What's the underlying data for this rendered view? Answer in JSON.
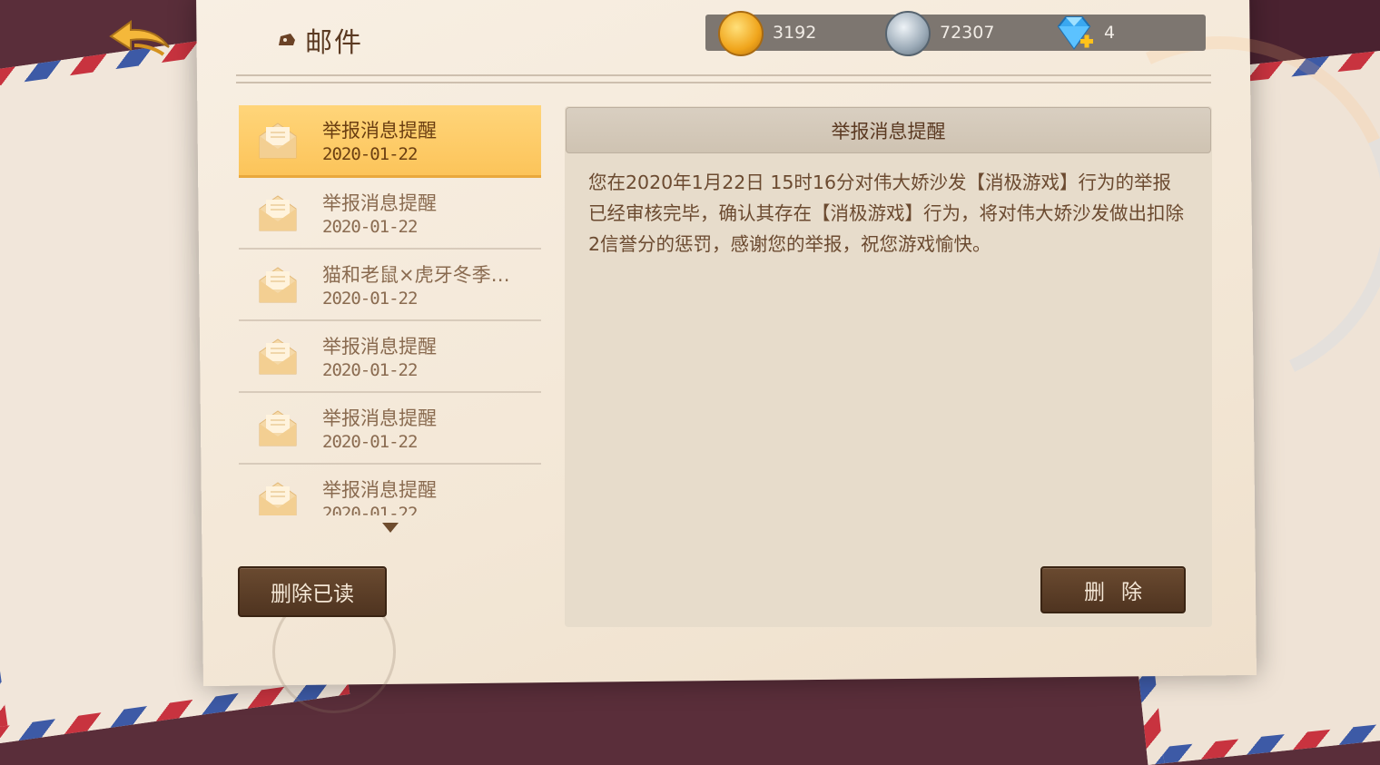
{
  "header": {
    "title": "邮件",
    "currencies": [
      {
        "name": "gold-coin",
        "value": "3192",
        "color": "#f0a51c"
      },
      {
        "name": "silver-coin",
        "value": "72307",
        "color": "#9aa9b6"
      },
      {
        "name": "diamond",
        "value": "4",
        "color": "#3aa8f0"
      }
    ]
  },
  "mail_list": {
    "items": [
      {
        "title": "举报消息提醒",
        "date": "2020-01-22",
        "selected": true
      },
      {
        "title": "举报消息提醒",
        "date": "2020-01-22",
        "selected": false
      },
      {
        "title": "猫和老鼠×虎牙冬季…",
        "date": "2020-01-22",
        "selected": false
      },
      {
        "title": "举报消息提醒",
        "date": "2020-01-22",
        "selected": false
      },
      {
        "title": "举报消息提醒",
        "date": "2020-01-22",
        "selected": false
      },
      {
        "title": "举报消息提醒",
        "date": "2020-01-22",
        "selected": false
      }
    ],
    "delete_read_label": "删除已读"
  },
  "mail_detail": {
    "title": "举报消息提醒",
    "body": "您在2020年1月22日 15时16分对伟大娇沙发【消极游戏】行为的举报已经审核完毕，确认其存在【消极游戏】行为，将对伟大娇沙发做出扣除2信誉分的惩罚，感谢您的举报，祝您游戏愉快。",
    "delete_label": "删除"
  }
}
